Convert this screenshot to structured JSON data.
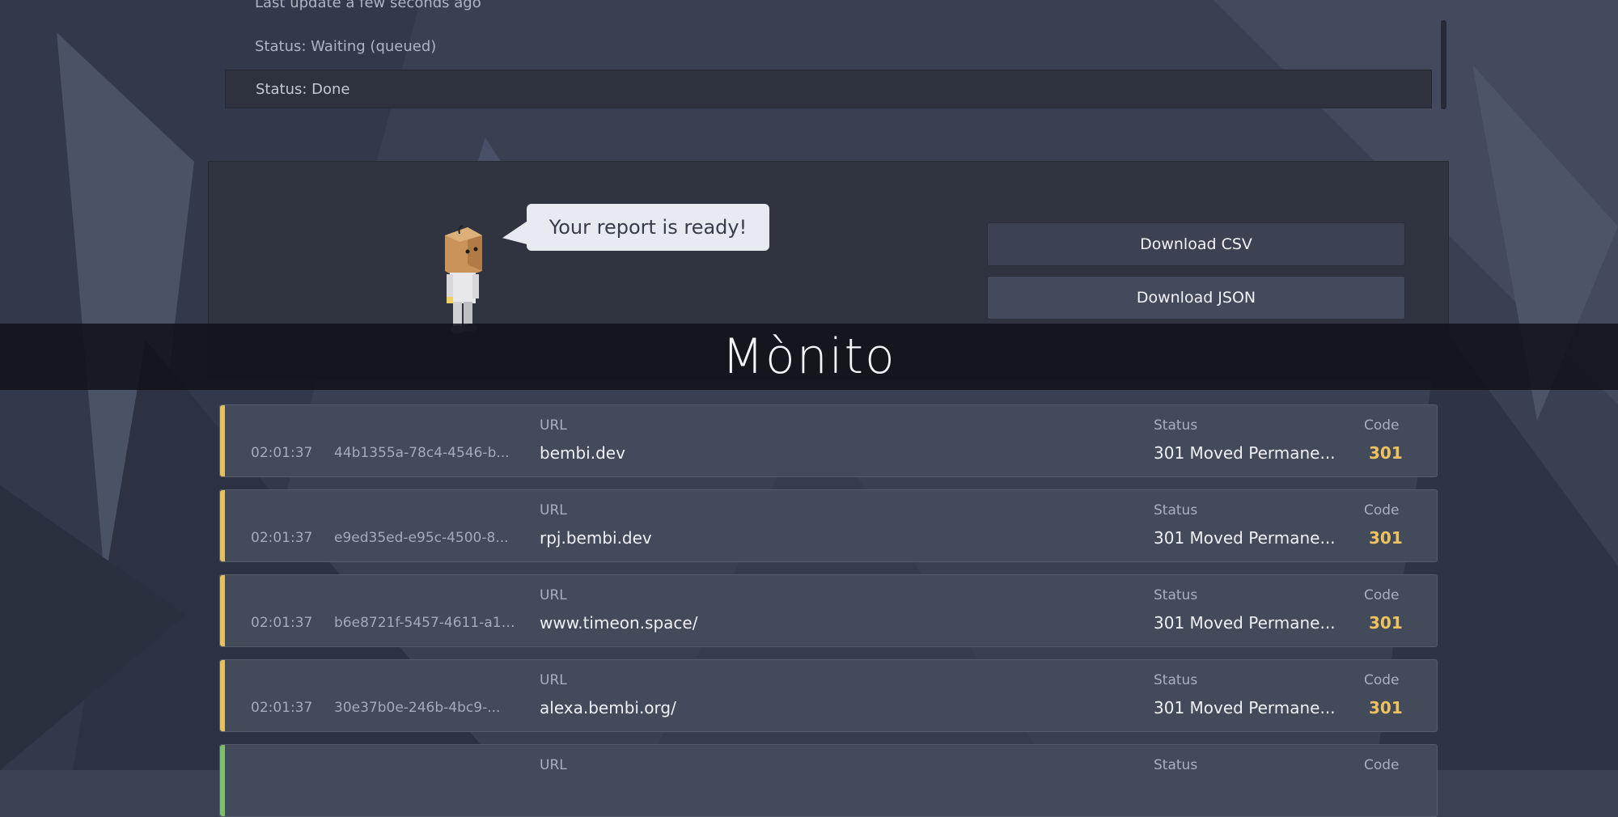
{
  "app": {
    "brand": "Mònito"
  },
  "status_list": {
    "items": [
      {
        "label": "Last update a few seconds ago"
      },
      {
        "label": "Status: Waiting (queued)"
      },
      {
        "label": "Status: Done"
      }
    ]
  },
  "report": {
    "message": "Your report is ready!",
    "download_csv": "Download CSV",
    "download_json": "Download JSON"
  },
  "labels": {
    "url": "URL",
    "status": "Status",
    "code": "Code"
  },
  "requests": [
    {
      "time": "02:01:37",
      "id": "44b1355a-78c4-4546-b...",
      "url": "bembi.dev",
      "status": "301 Moved Permane...",
      "code": "301"
    },
    {
      "time": "02:01:37",
      "id": "e9ed35ed-e95c-4500-8...",
      "url": "rpj.bembi.dev",
      "status": "301 Moved Permane...",
      "code": "301"
    },
    {
      "time": "02:01:37",
      "id": "b6e8721f-5457-4611-a18...",
      "url": "www.timeon.space/",
      "status": "301 Moved Permane...",
      "code": "301"
    },
    {
      "time": "02:01:37",
      "id": "30e37b0e-246b-4bc9-...",
      "url": "alexa.bembi.org/",
      "status": "301 Moved Permane...",
      "code": "301"
    }
  ],
  "colors": {
    "accent_warning": "#e6bf5e",
    "accent_success": "#7dc06b",
    "code_color": "#eec25f"
  }
}
